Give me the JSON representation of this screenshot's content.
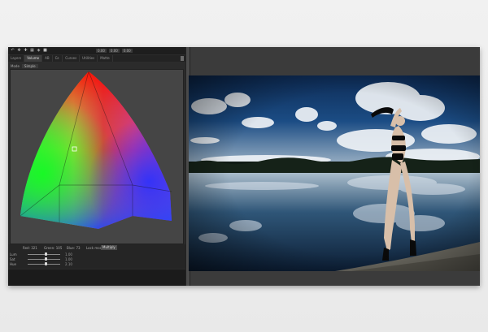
{
  "toolbar": {
    "icons": [
      "undo-icon",
      "move-icon",
      "crosshair-icon",
      "grid-icon",
      "node-icon",
      "square-icon"
    ],
    "fields": [
      "0.00",
      "0.00",
      "0.00"
    ]
  },
  "tabs": [
    {
      "label": "Layers"
    },
    {
      "label": "Volume",
      "active": true
    },
    {
      "label": "AB"
    },
    {
      "label": "Gr."
    },
    {
      "label": "Curves"
    },
    {
      "label": "Utilities"
    },
    {
      "label": "Matte"
    }
  ],
  "mode": {
    "label": "Mode",
    "value": "Simple"
  },
  "controls": {
    "stats": [
      {
        "label": "Red: 321"
      },
      {
        "label": "Green: 105"
      },
      {
        "label": "Blue: 73"
      }
    ],
    "sliders": [
      {
        "label": "Lum",
        "value": "1.00"
      },
      {
        "label": "Sat",
        "value": "1.00"
      },
      {
        "label": "Hue",
        "value": "2.10"
      }
    ],
    "auto_mode_label": "Lock mode",
    "auto_mode_value": "Multiply"
  },
  "colors": {
    "panel": "#2b2b2b",
    "canvas": "#454545",
    "accent": "#3d3d3d"
  }
}
